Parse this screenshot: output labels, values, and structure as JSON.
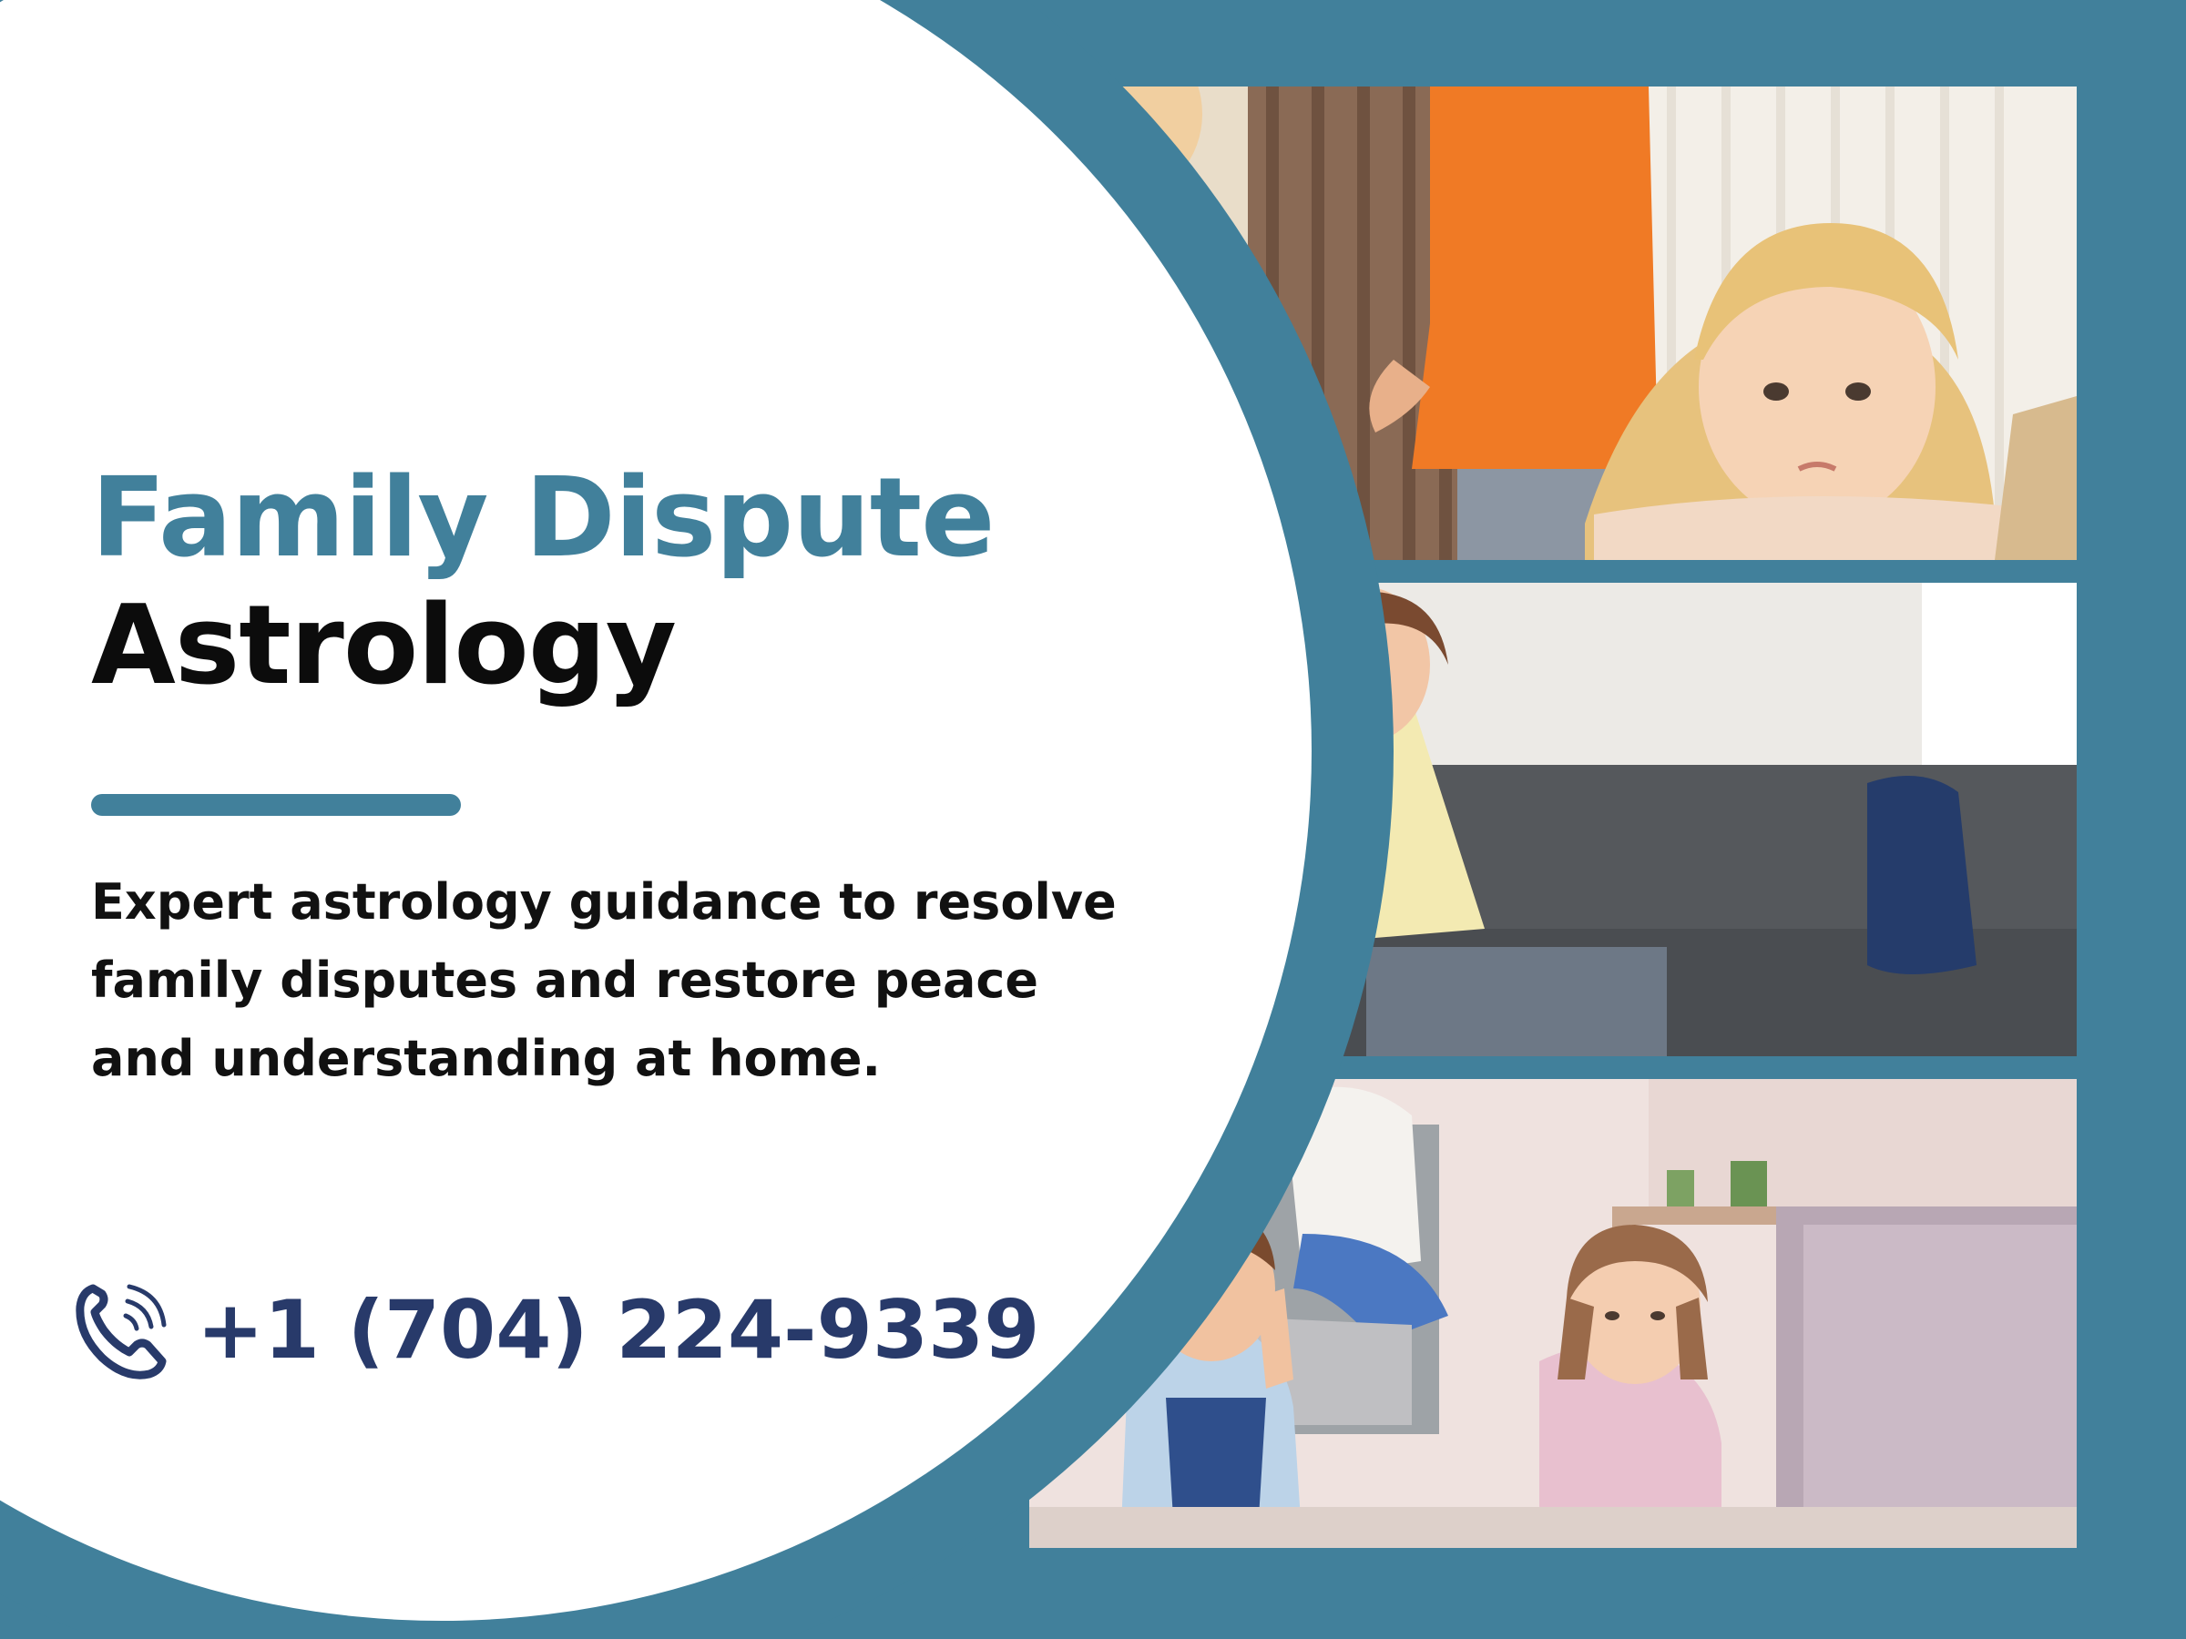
{
  "headline": {
    "line1": "Family Dispute",
    "line2": "Astrology"
  },
  "description": "Expert astrology guidance to resolve family disputes and restore peace and understanding at home.",
  "contact": {
    "phone": "+1 (704) 224-9339",
    "icon": "phone-icon"
  },
  "photos": [
    {
      "icon": "photo-girl-sad"
    },
    {
      "icon": "photo-mother-son-couch"
    },
    {
      "icon": "photo-children-covering-ears"
    }
  ],
  "colors": {
    "teal": "#41809b",
    "headline_dark": "#0c0c0c",
    "phone_navy": "#283a6a",
    "background_white": "#ffffff"
  }
}
